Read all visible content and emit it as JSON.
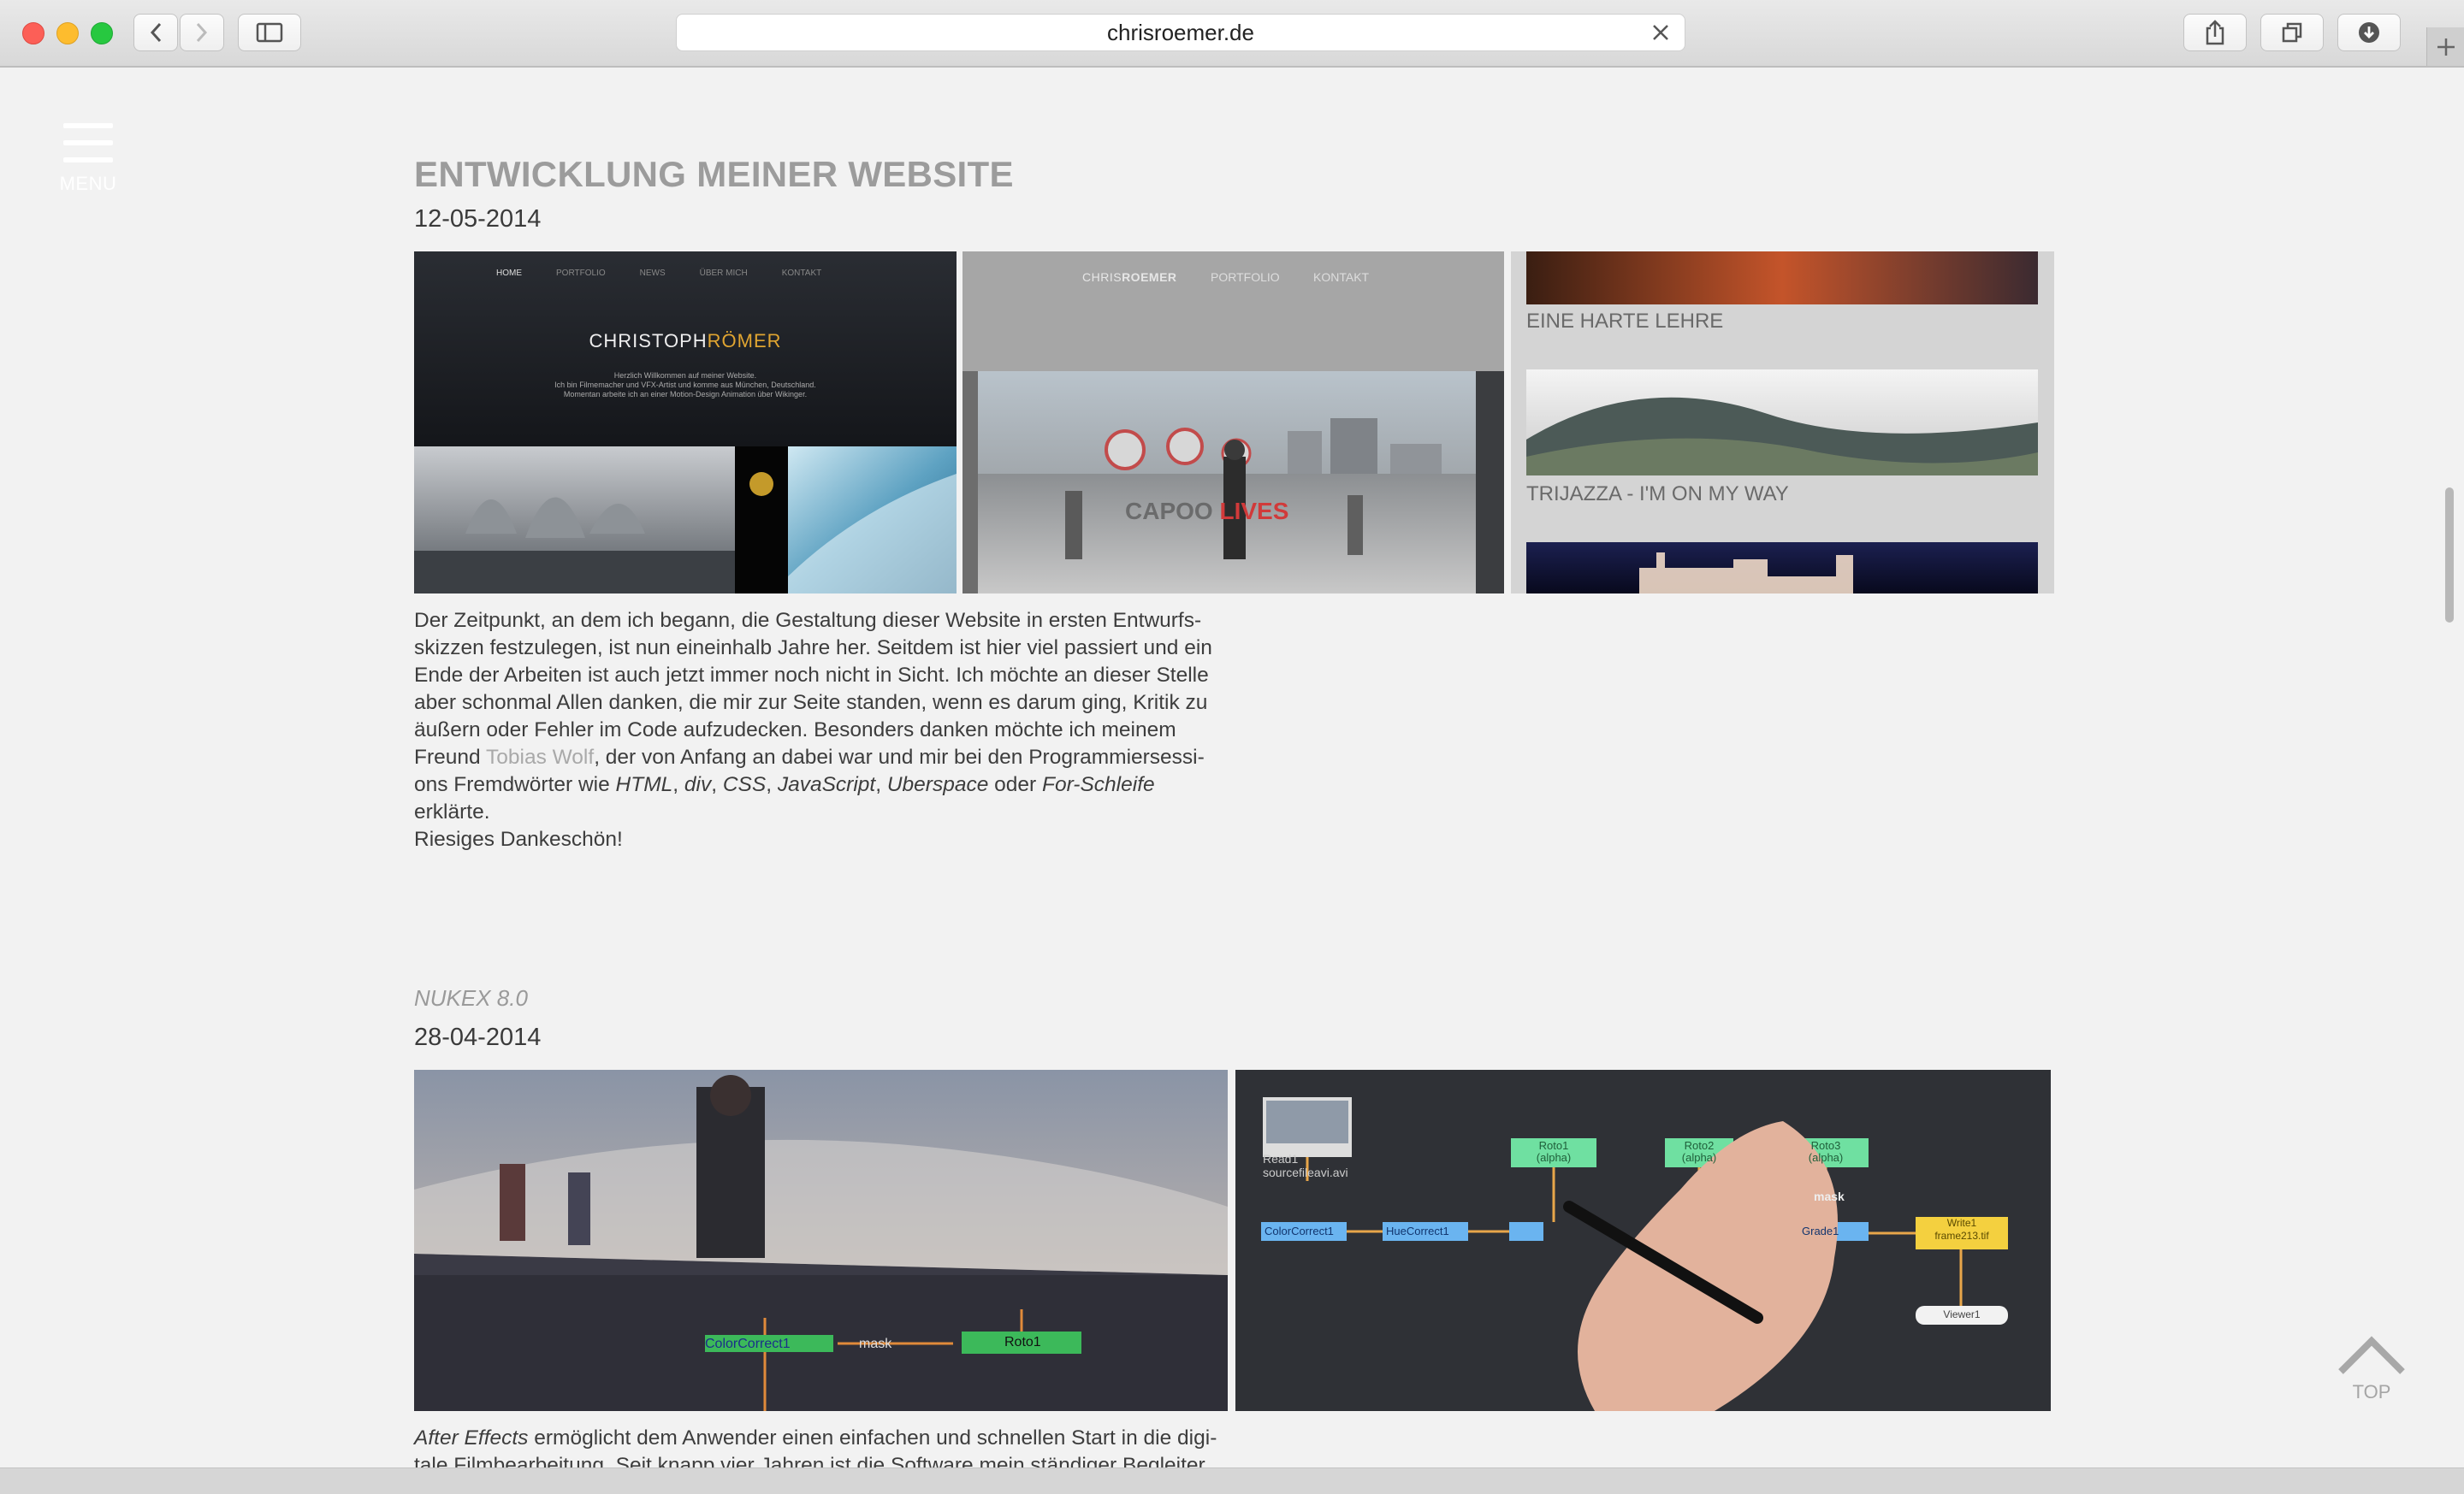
{
  "browser": {
    "url": "chrisroemer.de"
  },
  "page": {
    "menu_label": "MENU",
    "top_label": "TOP"
  },
  "post1": {
    "title": "ENTWICKLUNG MEINER WEBSITE",
    "date": "12-05-2014",
    "shot1": {
      "nav": [
        "HOME",
        "PORTFOLIO",
        "NEWS",
        "ÜBER MICH",
        "KONTAKT"
      ],
      "brand_a": "CHRISTOPH",
      "brand_b": "RÖMER",
      "tag1": "Herzlich Willkommen auf meiner Website.",
      "tag2": "Ich bin Filmemacher und VFX-Artist und komme aus München, Deutschland.",
      "tag3": "Momentan arbeite ich an einer Motion-Design Animation über Wikinger."
    },
    "shot2": {
      "brand_a": "CHRIS",
      "brand_b": "ROEMER",
      "nav1": "PORTFOLIO",
      "nav2": "KONTAKT",
      "overlay_a": "CAPOO",
      "overlay_b": "LIVES"
    },
    "shot3": {
      "item1": "EINE HARTE LEHRE",
      "item2": "TRIJAZZA - I'M ON MY WAY"
    },
    "body": {
      "p1": "Der Zeitpunkt, an dem ich begann, die Gestaltung dieser Website in ersten Entwurfs-",
      "p2": "skizzen festzulegen, ist nun eineinhalb Jahre her. Seitdem ist hier viel passiert und ein",
      "p3": "Ende der Arbeiten ist auch jetzt immer noch nicht in Sicht. Ich möchte an dieser Stelle",
      "p4": "aber schonmal Allen danken, die mir zur Seite standen, wenn es darum ging, Kritik zu",
      "p5": "äußern oder Fehler im Code aufzudecken. Besonders danken möchte ich meinem",
      "p6a": "Freund ",
      "link": "Tobias Wolf",
      "p6b": ", der von Anfang an dabei war und mir bei den Programmiersessi-",
      "p7a": "ons Fremdwörter wie ",
      "em1": "HTML",
      "c1": ", ",
      "em2": "div",
      "c2": ", ",
      "em3": "CSS",
      "c3": ", ",
      "em4": "JavaScript",
      "c4": ", ",
      "em5": "Uberspace",
      "p7b": " oder ",
      "em6": "For-Schleife",
      "p7c": " erklärte.",
      "p8": "Riesiges Dankeschön!"
    }
  },
  "post2": {
    "title": "NUKEX 8.0",
    "date": "28-04-2014",
    "shot1": {
      "node1": "ColorCorrect1",
      "node2": "mask",
      "node3": "Roto1"
    },
    "shot2": {
      "read": "Read1",
      "file": "sourcefileavi.avi",
      "cc": "ColorCorrect1",
      "hue": "HueCorrect1",
      "roto1": "Roto1",
      "roto2": "Roto2",
      "roto3": "Roto3",
      "alpha": "(alpha)",
      "mask": "mask",
      "grade": "Grade1",
      "write": "Write1",
      "writefile": "frame213.tif",
      "viewer": "Viewer1"
    },
    "body": {
      "em1": "After Effects",
      "l1": " ermöglicht dem Anwender einen einfachen und schnellen Start in die digi-",
      "l2": "tale Filmbearbeitung. Seit knapp vier Jahren ist die Software mein ständiger Begleiter"
    }
  }
}
